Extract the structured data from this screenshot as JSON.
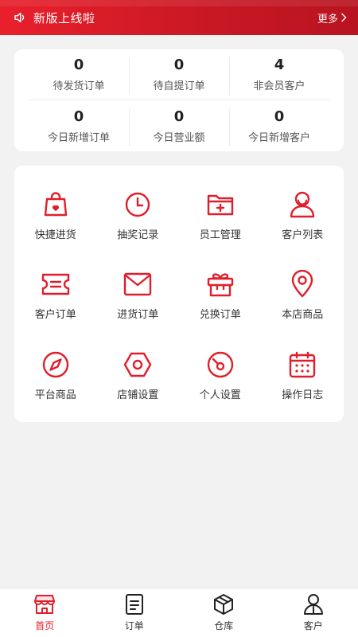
{
  "banner": {
    "title": "新版上线啦",
    "more_label": "更多"
  },
  "stats": [
    [
      {
        "value": "0",
        "label": "待发货订单"
      },
      {
        "value": "0",
        "label": "待自提订单"
      },
      {
        "value": "4",
        "label": "非会员客户"
      }
    ],
    [
      {
        "value": "0",
        "label": "今日新增订单"
      },
      {
        "value": "0",
        "label": "今日营业额"
      },
      {
        "value": "0",
        "label": "今日新增客户"
      }
    ]
  ],
  "menu": [
    {
      "label": "快捷进货",
      "icon": "shopping-bag-icon"
    },
    {
      "label": "抽奖记录",
      "icon": "clock-icon"
    },
    {
      "label": "员工管理",
      "icon": "folder-plus-icon"
    },
    {
      "label": "客户列表",
      "icon": "user-icon"
    },
    {
      "label": "客户订单",
      "icon": "ticket-icon"
    },
    {
      "label": "进货订单",
      "icon": "mail-icon"
    },
    {
      "label": "兑换订单",
      "icon": "gift-icon"
    },
    {
      "label": "本店商品",
      "icon": "location-pin-icon"
    },
    {
      "label": "平台商品",
      "icon": "compass-icon"
    },
    {
      "label": "店铺设置",
      "icon": "hexagon-nut-icon"
    },
    {
      "label": "个人设置",
      "icon": "gauge-icon"
    },
    {
      "label": "操作日志",
      "icon": "calendar-icon"
    }
  ],
  "tabs": [
    {
      "label": "首页",
      "icon": "store-icon",
      "active": true
    },
    {
      "label": "订单",
      "icon": "document-icon",
      "active": false
    },
    {
      "label": "仓库",
      "icon": "box-icon",
      "active": false
    },
    {
      "label": "客户",
      "icon": "person-icon",
      "active": false
    }
  ],
  "colors": {
    "accent": "#e01e2b",
    "banner": "#c81824",
    "background": "#f2f2f2"
  }
}
